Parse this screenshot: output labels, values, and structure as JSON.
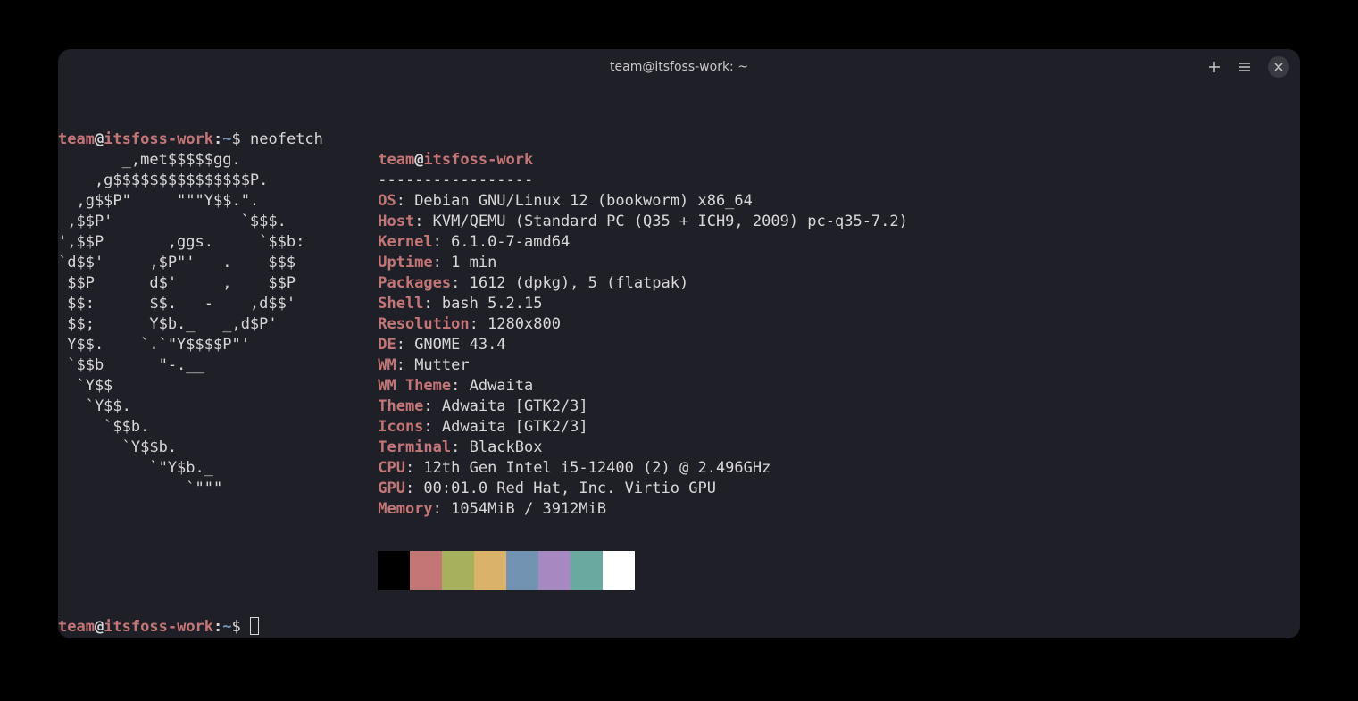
{
  "titlebar": {
    "title": "team@itsfoss-work: ~"
  },
  "prompt": {
    "user": "team",
    "at": "@",
    "host": "itsfoss-work",
    "colon": ":",
    "path": "~",
    "dollar": "$ "
  },
  "command": "neofetch",
  "ascii": [
    "       _,met$$$$$gg.",
    "    ,g$$$$$$$$$$$$$$$P.",
    "  ,g$$P\"     \"\"\"Y$$.\".",
    " ,$$P'              `$$$.",
    "',$$P       ,ggs.     `$$b:",
    "`d$$'     ,$P\"'   .    $$$",
    " $$P      d$'     ,    $$P",
    " $$:      $$.   -    ,d$$'",
    " $$;      Y$b._   _,d$P'",
    " Y$$.    `.`\"Y$$$$P\"'",
    " `$$b      \"-.__",
    "  `Y$$",
    "   `Y$$.",
    "     `$$b.",
    "       `Y$$b.",
    "          `\"Y$b._",
    "              `\"\"\""
  ],
  "info_header": {
    "user": "team",
    "at": "@",
    "host": "itsfoss-work"
  },
  "info_separator": "-----------------",
  "info": [
    {
      "label": "OS",
      "value": "Debian GNU/Linux 12 (bookworm) x86_64"
    },
    {
      "label": "Host",
      "value": "KVM/QEMU (Standard PC (Q35 + ICH9, 2009) pc-q35-7.2)"
    },
    {
      "label": "Kernel",
      "value": "6.1.0-7-amd64"
    },
    {
      "label": "Uptime",
      "value": "1 min"
    },
    {
      "label": "Packages",
      "value": "1612 (dpkg), 5 (flatpak)"
    },
    {
      "label": "Shell",
      "value": "bash 5.2.15"
    },
    {
      "label": "Resolution",
      "value": "1280x800"
    },
    {
      "label": "DE",
      "value": "GNOME 43.4"
    },
    {
      "label": "WM",
      "value": "Mutter"
    },
    {
      "label": "WM Theme",
      "value": "Adwaita"
    },
    {
      "label": "Theme",
      "value": "Adwaita [GTK2/3]"
    },
    {
      "label": "Icons",
      "value": "Adwaita [GTK2/3]"
    },
    {
      "label": "Terminal",
      "value": "BlackBox"
    },
    {
      "label": "CPU",
      "value": "12th Gen Intel i5-12400 (2) @ 2.496GHz"
    },
    {
      "label": "GPU",
      "value": "00:01.0 Red Hat, Inc. Virtio GPU"
    },
    {
      "label": "Memory",
      "value": "1054MiB / 3912MiB"
    }
  ],
  "colors": [
    "#000000",
    "#c47676",
    "#a7b05b",
    "#dbb26a",
    "#7393b3",
    "#a689c0",
    "#6aa9a0",
    "#ffffff"
  ]
}
